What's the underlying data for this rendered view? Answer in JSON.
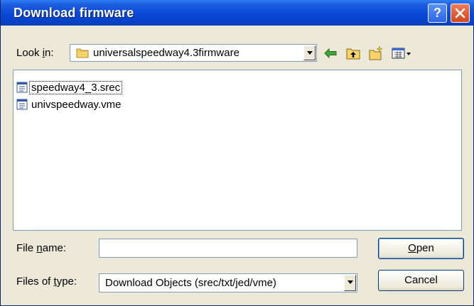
{
  "window": {
    "title": "Download firmware",
    "help_glyph": "?"
  },
  "lookin": {
    "label_pre": "Look ",
    "label_u": "i",
    "label_post": "n:",
    "value": "universalspeedway4.3firmware",
    "icon": "folder-icon"
  },
  "toolbar": {
    "icons": [
      "back-arrow-icon",
      "up-folder-icon",
      "new-folder-icon",
      "view-menu-icon"
    ]
  },
  "files": [
    {
      "name": "speedway4_3.srec",
      "icon": "file-icon",
      "focused": true
    },
    {
      "name": "univspeedway.vme",
      "icon": "file-icon",
      "focused": false
    }
  ],
  "filename": {
    "label_pre": "File ",
    "label_u": "n",
    "label_post": "ame:",
    "value": ""
  },
  "filetype": {
    "label_pre": "Files of ",
    "label_u": "t",
    "label_post": "ype:",
    "value": "Download Objects (srec/txt/jed/vme)"
  },
  "buttons": {
    "open_u": "O",
    "open_rest": "pen",
    "cancel": "Cancel"
  },
  "colors": {
    "title_bar": "#0a47d6",
    "close_button": "#d3441c",
    "help_button": "#2c66e6",
    "dialog_bg": "#ece9d8"
  }
}
